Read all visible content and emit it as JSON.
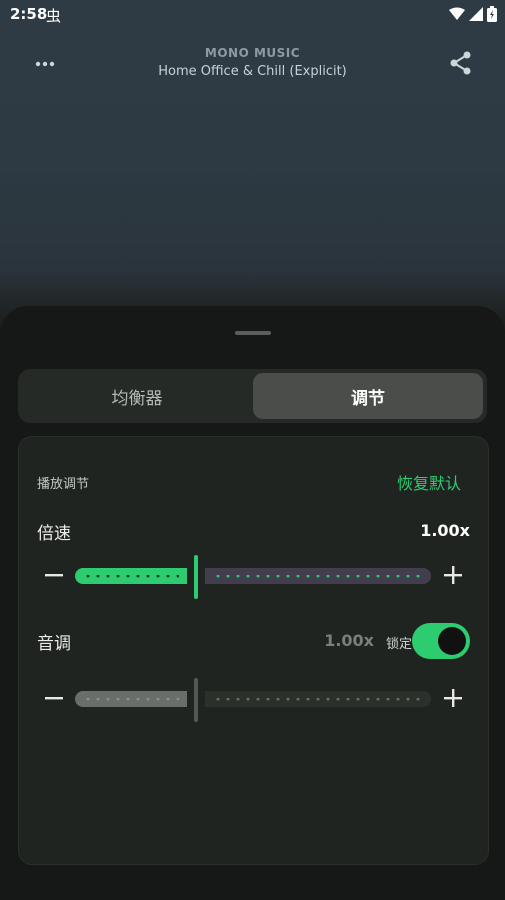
{
  "status": {
    "time": "2:58",
    "bug_glyph": "虫"
  },
  "header": {
    "app_name": "MONO MUSIC",
    "playlist": "Home Office & Chill (Explicit)"
  },
  "tabs": [
    {
      "label": "均衡器",
      "active": false
    },
    {
      "label": "调节",
      "active": true
    }
  ],
  "panel": {
    "section_title": "播放调节",
    "reset_label": "恢复默认",
    "speed": {
      "label": "倍速",
      "value": "1.00x",
      "fraction": 0.5
    },
    "pitch": {
      "label": "音调",
      "value": "1.00x",
      "lock_label": "锁定",
      "locked": true,
      "fraction": 0.5
    }
  },
  "colors": {
    "accent": "#2ecc71",
    "sheet_bg": "#151816",
    "card_bg": "#1f2420"
  }
}
